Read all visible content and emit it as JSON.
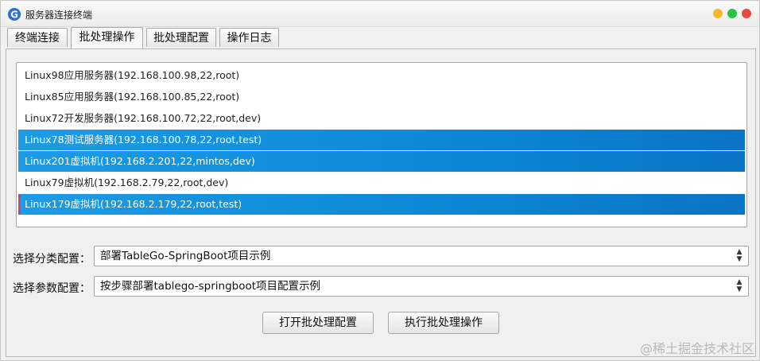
{
  "window": {
    "title": "服务器连接终端"
  },
  "tabs": [
    {
      "label": "终端连接",
      "active": false
    },
    {
      "label": "批处理操作",
      "active": true
    },
    {
      "label": "批处理配置",
      "active": false
    },
    {
      "label": "操作日志",
      "active": false
    }
  ],
  "server_list": [
    {
      "label": "Linux98应用服务器(192.168.100.98,22,root)",
      "selected": false
    },
    {
      "label": "Linux85应用服务器(192.168.100.85,22,root)",
      "selected": false
    },
    {
      "label": "Linux72开发服务器(192.168.100.72,22,root,dev)",
      "selected": false
    },
    {
      "label": "Linux78测试服务器(192.168.100.78,22,root,test)",
      "selected": true
    },
    {
      "label": "Linux201虚拟机(192.168.2.201,22,mintos,dev)",
      "selected": true
    },
    {
      "label": "Linux79虚拟机(192.168.2.79,22,root,dev)",
      "selected": false
    },
    {
      "label": "Linux179虚拟机(192.168.2.179,22,root,test)",
      "selected": true
    }
  ],
  "category_select": {
    "label": "选择分类配置：",
    "value": "部署TableGo-SpringBoot项目示例"
  },
  "param_select": {
    "label": "选择参数配置：",
    "value": "按步骤部署tablego-springboot项目配置示例"
  },
  "buttons": {
    "open_config": "打开批处理配置",
    "run_batch": "执行批处理操作"
  },
  "watermark": "@稀土掘金技术社区",
  "colors": {
    "selection": "#1390e0",
    "traffic_yellow": "#f5b82c",
    "traffic_green": "#27c43f",
    "traffic_red": "#e84a3f"
  }
}
